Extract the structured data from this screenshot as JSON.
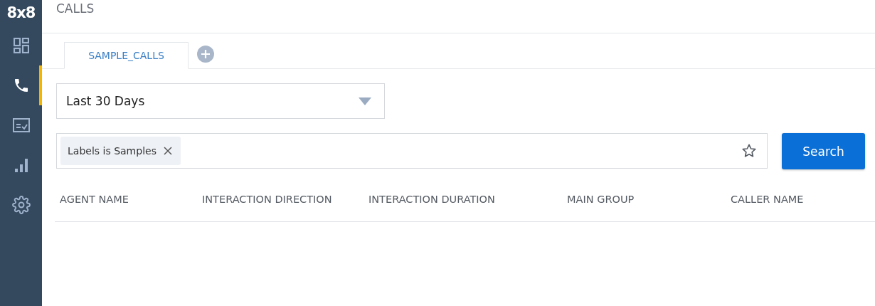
{
  "logo": "8x8",
  "sidebar": {
    "items": [
      {
        "kind": "dashboard",
        "selected": false
      },
      {
        "kind": "phone",
        "selected": true
      },
      {
        "kind": "form",
        "selected": false
      },
      {
        "kind": "chart",
        "selected": false
      },
      {
        "kind": "settings",
        "selected": false
      }
    ]
  },
  "header": {
    "title": "CALLS"
  },
  "tabs": [
    {
      "label": "SAMPLE_CALLS",
      "selected": true
    }
  ],
  "date_range": {
    "value": "Last 30 Days"
  },
  "filter": {
    "chips": [
      {
        "label": "Labels is Samples"
      }
    ]
  },
  "search_button": "Search",
  "table": {
    "columns": [
      "AGENT NAME",
      "INTERACTION DIRECTION",
      "INTERACTION DURATION",
      "MAIN GROUP",
      "CALLER NAME"
    ]
  }
}
